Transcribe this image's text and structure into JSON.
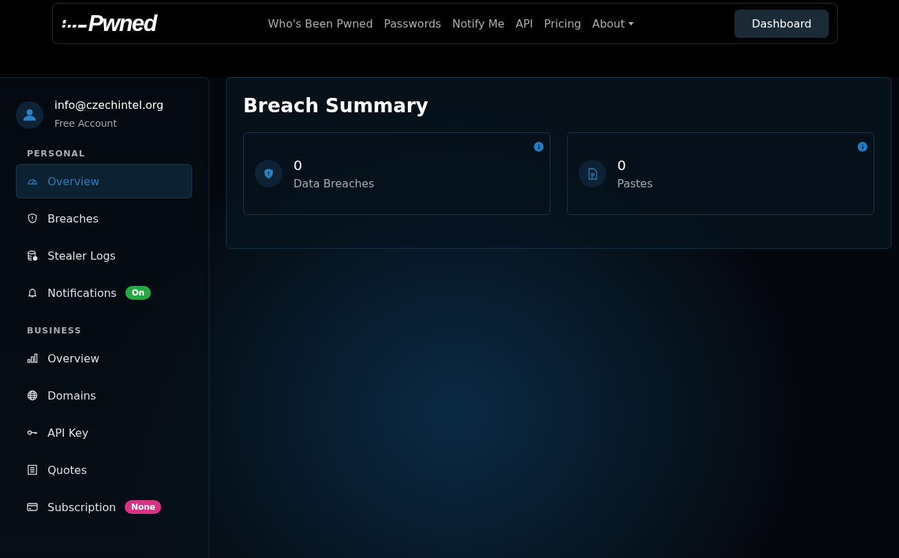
{
  "navbar": {
    "logo_text": "Pwned",
    "links": [
      {
        "label": "Who's Been Pwned",
        "dropdown": false
      },
      {
        "label": "Passwords",
        "dropdown": false
      },
      {
        "label": "Notify Me",
        "dropdown": false
      },
      {
        "label": "API",
        "dropdown": false
      },
      {
        "label": "Pricing",
        "dropdown": false
      },
      {
        "label": "About",
        "dropdown": true
      }
    ],
    "button": "Dashboard"
  },
  "sidebar": {
    "user": {
      "email": "info@czechintel.org",
      "plan": "Free Account"
    },
    "sections": [
      {
        "title": "PERSONAL",
        "items": [
          {
            "label": "Overview",
            "selected": true
          },
          {
            "label": "Breaches",
            "selected": false
          },
          {
            "label": "Stealer Logs",
            "selected": false
          },
          {
            "label": "Notifications",
            "selected": false,
            "badge": {
              "text": "On",
              "color": "#28a745"
            }
          }
        ]
      },
      {
        "title": "BUSINESS",
        "items": [
          {
            "label": "Overview",
            "selected": false
          },
          {
            "label": "Domains",
            "selected": false
          },
          {
            "label": "API Key",
            "selected": false
          },
          {
            "label": "Quotes",
            "selected": false
          },
          {
            "label": "Subscription",
            "selected": false,
            "badge": {
              "text": "None",
              "color": "#d63384"
            }
          }
        ]
      }
    ]
  },
  "main": {
    "title": "Breach Summary",
    "cards": [
      {
        "kind": "breaches",
        "value": "0",
        "label": "Data Breaches"
      },
      {
        "kind": "pastes",
        "value": "0",
        "label": "Pastes"
      }
    ]
  }
}
